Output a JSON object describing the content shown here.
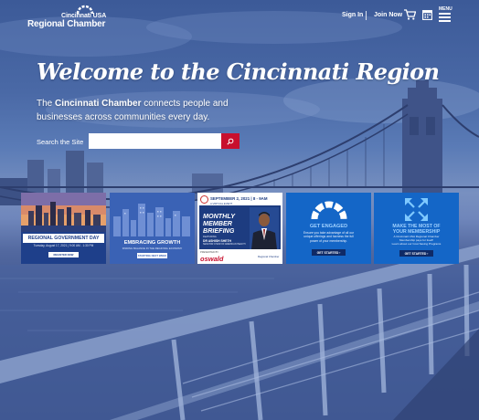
{
  "header": {
    "logo_top": "Cincinnati USA",
    "logo_main": "Regional Chamber",
    "signin_label": "Sign In",
    "join_label": "Join Now",
    "menu_label": "MENU"
  },
  "hero": {
    "title": "Welcome to the Cincinnati Region",
    "subtitle_pre": "The ",
    "subtitle_bold": "Cincinnati Chamber",
    "subtitle_post": " connects people and businesses across communities every day.",
    "search_label": "Search the Site",
    "search_value": "",
    "search_placeholder": ""
  },
  "cards": [
    {
      "title": "REGIONAL GOVERNMENT DAY",
      "date": "Tuesday, August 17, 2021 | 9:00 AM - 1:30 PM",
      "button": "REGISTER NOW"
    },
    {
      "title": "EMBRACING GROWTH",
      "subtitle": "FINDING BALANCE IN THE REGIONAL ECONOMY",
      "button": "STARTING NEXT WEEK"
    },
    {
      "date": "SEPTEMBER 2, 2021 | 8 - 9AM",
      "virtual": "A VIRTUAL EVENT",
      "line1": "MONTHLY",
      "line2": "MEMBER",
      "line3": "BRIEFING",
      "featuring": "FEATURING",
      "speaker": "DR ASHISH SHETH",
      "role": "SENATOR CHAIR OF AMERICAN HEALTH",
      "sponsor_label": "PRESENTED BY",
      "sponsor": "oswald",
      "org": "Regional Chamber"
    },
    {
      "title": "GET ENGAGED",
      "description": "Ensure you take advantage of all our\nunique offerings and harness the full\npower of your membership.",
      "button": "GET STARTED ›"
    },
    {
      "title": "MAKE THE MOST OF\nYOUR MEMBERSHIP",
      "description": "A Cincinnati USA Regional Chamber\nMembership pays for itself!\nLearn about our Cost Saving Programs",
      "button": "GET STARTED ›"
    }
  ],
  "colors": {
    "accent_red": "#c8102e",
    "navy": "#1d3c80",
    "card_blue": "#1466c7"
  },
  "icons": [
    "cart-icon",
    "calendar-icon",
    "menu-icon",
    "search-icon",
    "gauge-icon",
    "expand-arrows-icon"
  ]
}
